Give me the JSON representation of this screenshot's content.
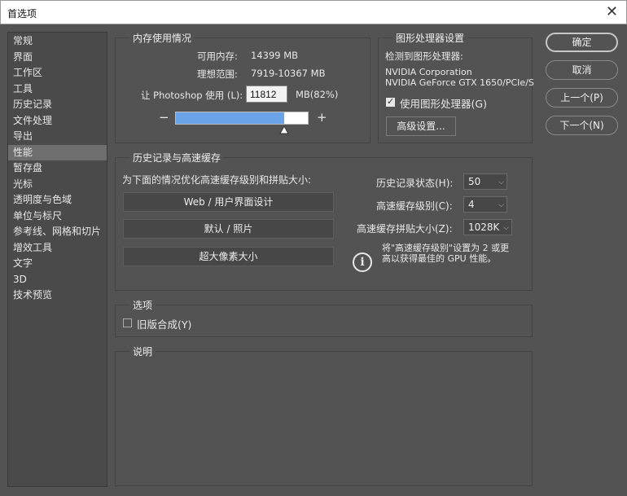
{
  "window": {
    "title": "首选项",
    "close_glyph": "✕"
  },
  "sidebar": {
    "items": [
      {
        "label": "常规"
      },
      {
        "label": "界面"
      },
      {
        "label": "工作区"
      },
      {
        "label": "工具"
      },
      {
        "label": "历史记录"
      },
      {
        "label": "文件处理"
      },
      {
        "label": "导出"
      },
      {
        "label": "性能"
      },
      {
        "label": "暂存盘"
      },
      {
        "label": "光标"
      },
      {
        "label": "透明度与色域"
      },
      {
        "label": "单位与标尺"
      },
      {
        "label": "参考线、网格和切片"
      },
      {
        "label": "增效工具"
      },
      {
        "label": "文字"
      },
      {
        "label": "3D"
      },
      {
        "label": "技术预览"
      }
    ],
    "selected": "性能"
  },
  "memory": {
    "title": "内存使用情况",
    "available_label": "可用内存:",
    "available_value": "14399 MB",
    "ideal_label": "理想范围:",
    "ideal_value": "7919-10367 MB",
    "let_label": "让 Photoshop 使用 (L):",
    "let_value": "11812",
    "let_unit": "MB(82%)",
    "minus": "−",
    "plus": "+",
    "usage_percent": 82
  },
  "gpu": {
    "title": "图形处理器设置",
    "detected_label": "检测到图形处理器:",
    "vendor": "NVIDIA Corporation",
    "model": "NVIDIA GeForce GTX 1650/PCIe/S",
    "use_gpu_label": "使用图形处理器(G)",
    "use_gpu_checked": true,
    "advanced_button": "高级设置..."
  },
  "history_cache": {
    "title": "历史记录与高速缓存",
    "optimize_label": "为下面的情况优化高速缓存级别和拼贴大小:",
    "preset_web": "Web / 用户界面设计",
    "preset_default": "默认 / 照片",
    "preset_huge": "超大像素大小",
    "history_states_label": "历史记录状态(H):",
    "history_states_value": "50",
    "cache_levels_label": "高速缓存级别(C):",
    "cache_levels_value": "4",
    "cache_tile_label": "高速缓存拼贴大小(Z):",
    "cache_tile_value": "1028K",
    "tip_line1": "将\"高速缓存级别\"设置为 2 或更",
    "tip_line2": "高以获得最佳的 GPU 性能。",
    "info_glyph": "i"
  },
  "options": {
    "title": "选项",
    "legacy_label": "旧版合成(Y)",
    "legacy_checked": false
  },
  "description": {
    "title": "说明"
  },
  "buttons": {
    "ok": "确定",
    "cancel": "取消",
    "prev": "上一个(P)",
    "next": "下一个(N)"
  }
}
